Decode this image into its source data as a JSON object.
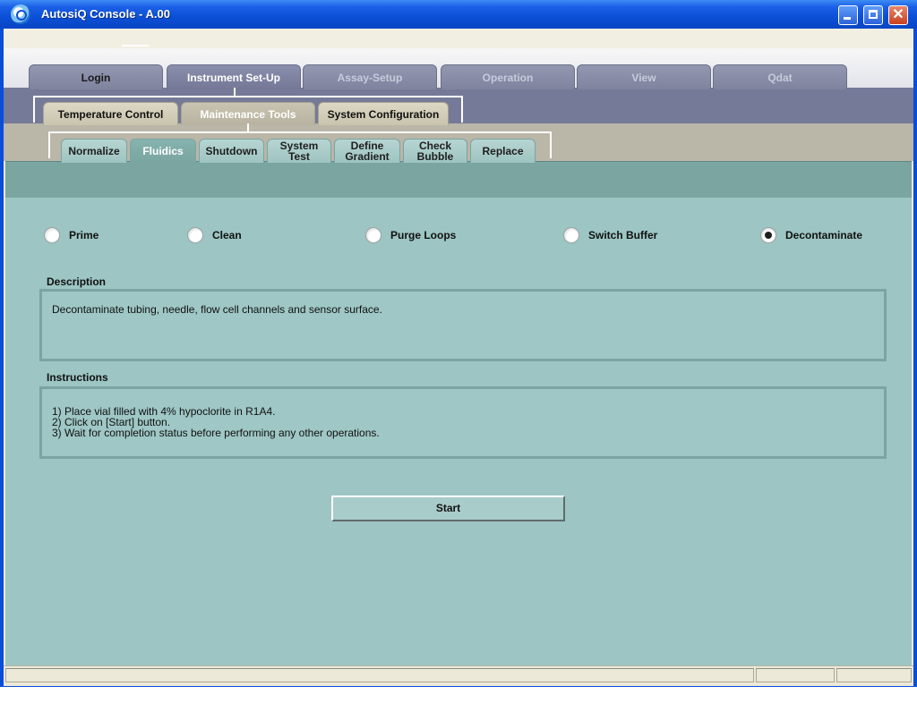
{
  "window": {
    "title": "AutosiQ Console - A.00"
  },
  "main_tabs": [
    {
      "label": "Login",
      "active": false
    },
    {
      "label": "Instrument Set-Up",
      "active": true
    },
    {
      "label": "Assay-Setup",
      "active": false
    },
    {
      "label": "Operation",
      "active": false
    },
    {
      "label": "View",
      "active": false
    },
    {
      "label": "Qdat",
      "active": false
    }
  ],
  "setup_tabs": [
    {
      "label": "Temperature Control",
      "active": false
    },
    {
      "label": "Maintenance Tools",
      "active": true
    },
    {
      "label": "System Configuration",
      "active": false
    }
  ],
  "maintenance_tabs": [
    {
      "label": "Normalize",
      "active": false
    },
    {
      "label": "Fluidics",
      "active": true
    },
    {
      "label": "Shutdown",
      "active": false
    },
    {
      "label_line1": "System",
      "label_line2": "Test",
      "active": false
    },
    {
      "label_line1": "Define",
      "label_line2": "Gradient",
      "active": false
    },
    {
      "label_line1": "Check",
      "label_line2": "Bubble",
      "active": false
    },
    {
      "label": "Replace",
      "active": false
    }
  ],
  "fluidics_options": [
    {
      "label": "Prime",
      "checked": false
    },
    {
      "label": "Clean",
      "checked": false
    },
    {
      "label": "Purge Loops",
      "checked": false
    },
    {
      "label": "Switch Buffer",
      "checked": false
    },
    {
      "label": "Decontaminate",
      "checked": true
    }
  ],
  "description": {
    "label": "Description",
    "text": "Decontaminate tubing, needle, flow cell channels and sensor surface."
  },
  "instructions": {
    "label": "Instructions",
    "lines": [
      "1) Place vial filled with 4% hypoclorite in R1A4.",
      "2) Click on [Start] button.",
      "3) Wait for completion status before performing any other operations."
    ]
  },
  "start_button": {
    "label": "Start"
  },
  "icons": {
    "app": "autosiq-app-icon",
    "minimize": "minimize-icon",
    "maximize": "maximize-icon",
    "close": "close-icon"
  },
  "colors": {
    "titlebar": "#0b4fd6",
    "main_tab_band": "#757a98",
    "setup_tab_band": "#bab6a8",
    "content_bg": "#9cc5c3",
    "panel_border": "#7aa5a1"
  }
}
